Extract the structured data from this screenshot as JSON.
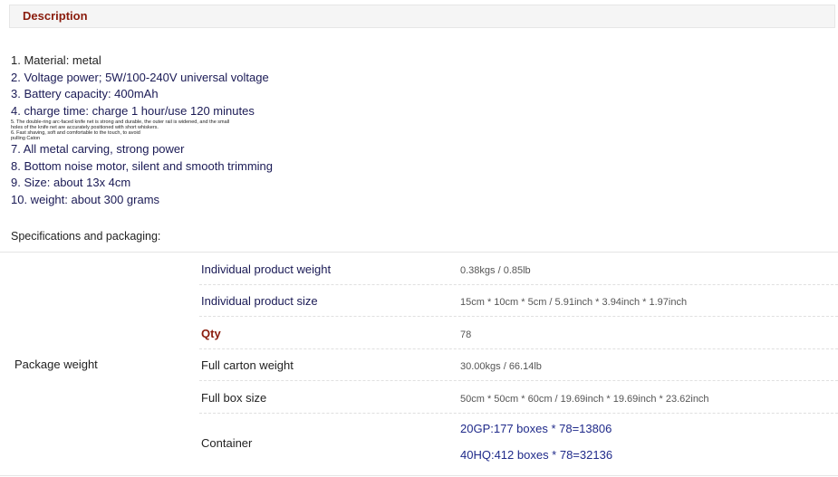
{
  "header": {
    "title": "Description"
  },
  "list_items": [
    {
      "text": "1. Material: metal"
    },
    {
      "text": "2. Voltage power; 5W/100-240V universal voltage"
    },
    {
      "text": "3. Battery capacity: 400mAh"
    },
    {
      "text": "4. charge time: charge 1 hour/use 120 minutes"
    }
  ],
  "tiny_lines": [
    "5. The double-ring arc-faced knife net is strong and durable, the outer rail is widened, and the small",
    "holes of the knife net are accurately positioned with short whiskers.",
    "6. Fast shaving, soft and comfortable to the touch, to avoid",
    "pulling Caton"
  ],
  "list_items_2": [
    {
      "text": "7. All metal carving, strong power"
    },
    {
      "text": "8. Bottom noise motor, silent and smooth trimming"
    },
    {
      "text": "9. Size: about 13x 4cm"
    },
    {
      "text": "10. weight: about 300 grams"
    }
  ],
  "specs": {
    "title": "Specifications and packaging:",
    "group_label": "Package weight",
    "rows": [
      {
        "key": "Individual product weight",
        "value": "0.38kgs / 0.85lb"
      },
      {
        "key": "Individual product size",
        "value": "15cm * 10cm * 5cm / 5.91inch * 3.94inch * 1.97inch"
      },
      {
        "key": "Qty",
        "value": "78"
      },
      {
        "key": "Full carton weight",
        "value": "30.00kgs / 66.14lb"
      },
      {
        "key": "Full box size",
        "value": "50cm * 50cm * 60cm / 19.69inch * 19.69inch * 23.62inch"
      }
    ],
    "container": {
      "key": "Container",
      "values": [
        "20GP:177 boxes * 78=13806",
        "40HQ:412 boxes * 78=32136"
      ]
    }
  }
}
